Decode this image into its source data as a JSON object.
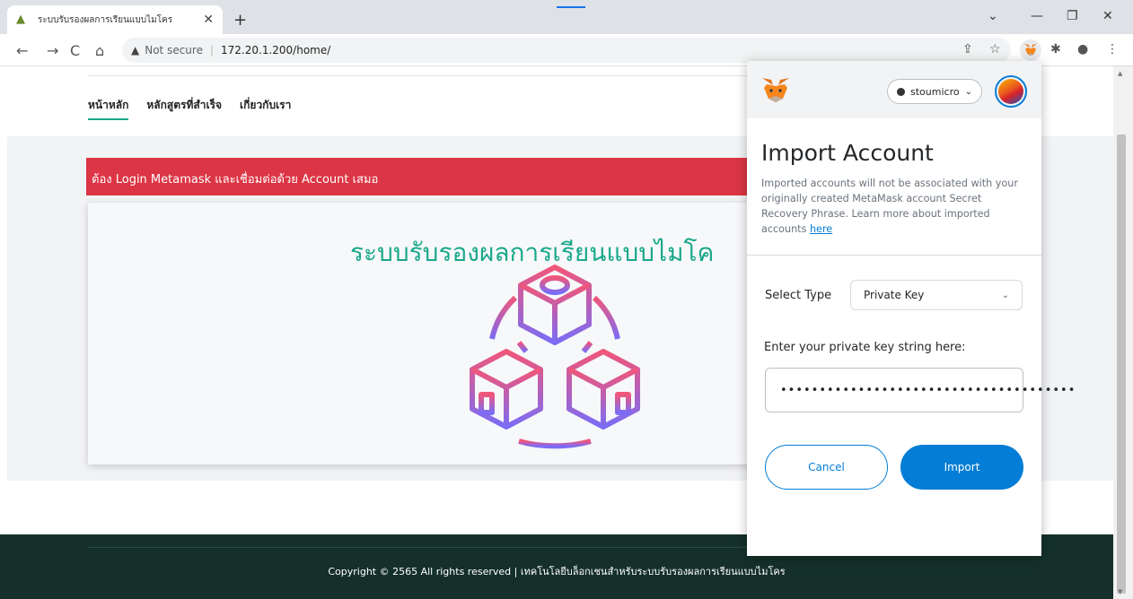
{
  "browser": {
    "tab_title": "ระบบรับรองผลการเรียนแบบไมโคร",
    "url_warning": "Not secure",
    "url": "172.20.1.200/home/"
  },
  "site": {
    "nav": [
      "หน้าหลัก",
      "หลักสูตรที่สำเร็จ",
      "เกี่ยวกับเรา"
    ],
    "alert": "ต้อง Login Metamask และเชื่อมต่อด้วย Account เสมอ",
    "card_title": "ระบบรับรองผลการเรียนแบบไมโค",
    "footer": "Copyright © 2565 All rights reserved | เทคโนโลยีบล็อกเชนสำหรับระบบรับรองผลการเรียนแบบไมโคร"
  },
  "metamask": {
    "network": "stoumicro",
    "title": "Import Account",
    "description": "Imported accounts will not be associated with your originally created MetaMask account Secret Recovery Phrase. Learn more about imported accounts",
    "description_link": "here",
    "select_label": "Select Type",
    "select_value": "Private Key",
    "key_label": "Enter your private key string here:",
    "key_value": "••••••••••••••••••••••••••••••••••••••",
    "cancel": "Cancel",
    "import": "Import"
  },
  "colors": {
    "accent_green": "#1aa88a",
    "alert_red": "#dc3545",
    "metamask_blue": "#037dd6",
    "footer_bg": "#15302a"
  }
}
